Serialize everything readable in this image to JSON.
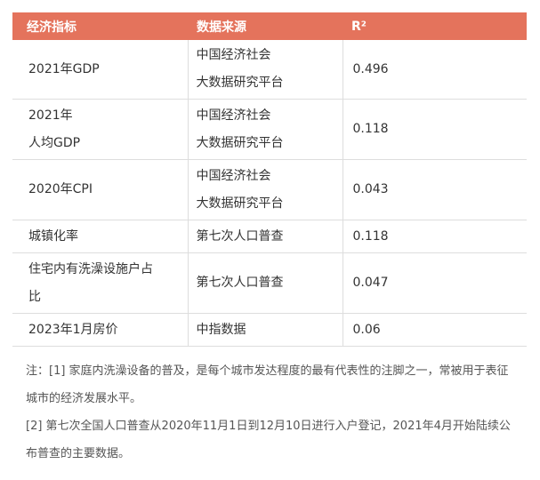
{
  "table": {
    "headers": [
      "经济指标",
      "数据来源",
      "R²"
    ],
    "rows": [
      {
        "indicator": [
          "2021年GDP"
        ],
        "source": [
          "中国经济社会",
          "大数据研究平台"
        ],
        "r2": "0.496"
      },
      {
        "indicator": [
          "2021年",
          "人均GDP"
        ],
        "source": [
          "中国经济社会",
          "大数据研究平台"
        ],
        "r2": "0.118"
      },
      {
        "indicator": [
          "2020年CPI"
        ],
        "source": [
          "中国经济社会",
          "大数据研究平台"
        ],
        "r2": "0.043"
      },
      {
        "indicator": [
          "城镇化率"
        ],
        "source": [
          "第七次人口普查"
        ],
        "r2": "0.118"
      },
      {
        "indicator": [
          "住宅内有洗澡设施户占",
          "比"
        ],
        "source": [
          "第七次人口普查"
        ],
        "r2": "0.047"
      },
      {
        "indicator": [
          "2023年1月房价"
        ],
        "source": [
          "中指数据"
        ],
        "r2": "0.06"
      }
    ]
  },
  "notes": [
    "注：[1] 家庭内洗澡设备的普及，是每个城市发达程度的最有代表性的注脚之一，常被用于表征城市的经济发展水平。",
    "[2] 第七次全国人口普查从2020年11月1日到12月10日进行入户登记，2021年4月开始陆续公布普查的主要数据。"
  ],
  "colors": {
    "header_bg": "#e4735c",
    "header_text": "#ffffff",
    "border": "#dddddd"
  }
}
